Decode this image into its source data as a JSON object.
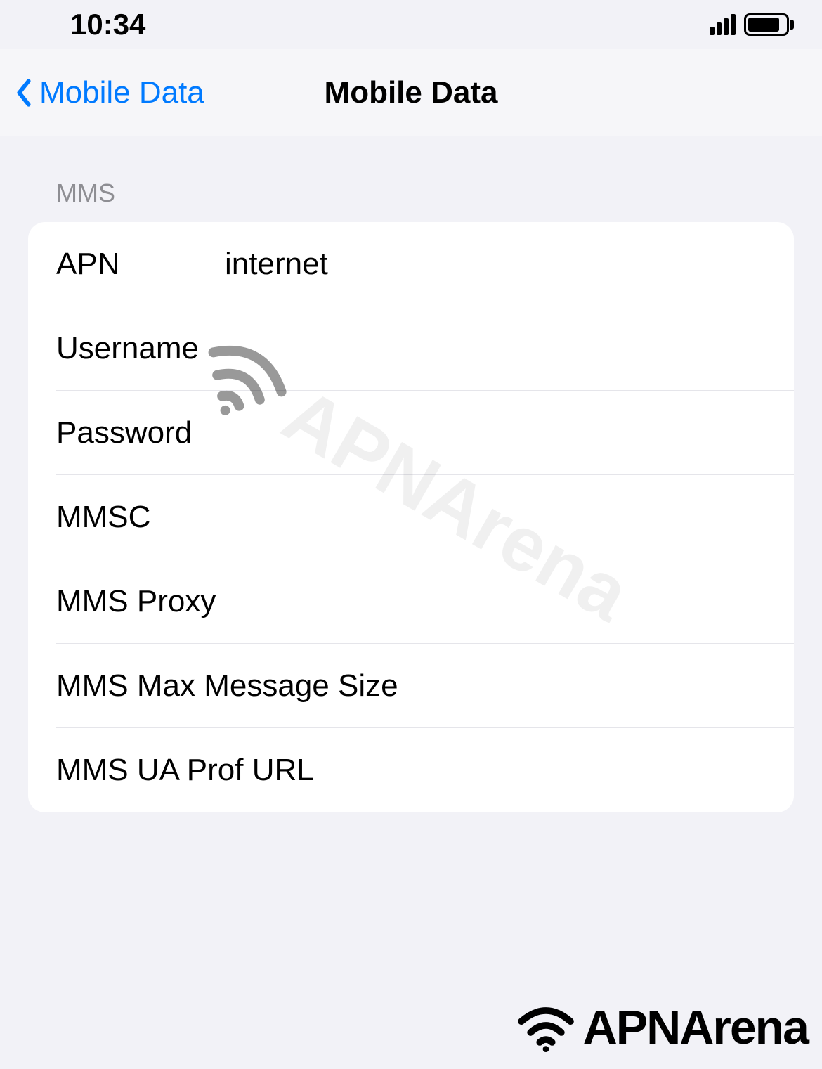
{
  "status_bar": {
    "time": "10:34"
  },
  "nav": {
    "back_label": "Mobile Data",
    "title": "Mobile Data"
  },
  "section": {
    "header": "MMS",
    "rows": [
      {
        "label": "APN",
        "value": "internet"
      },
      {
        "label": "Username",
        "value": ""
      },
      {
        "label": "Password",
        "value": ""
      },
      {
        "label": "MMSC",
        "value": ""
      },
      {
        "label": "MMS Proxy",
        "value": ""
      },
      {
        "label": "MMS Max Message Size",
        "value": ""
      },
      {
        "label": "MMS UA Prof URL",
        "value": ""
      }
    ]
  },
  "watermark": "APNArena",
  "footer": "APNArena"
}
